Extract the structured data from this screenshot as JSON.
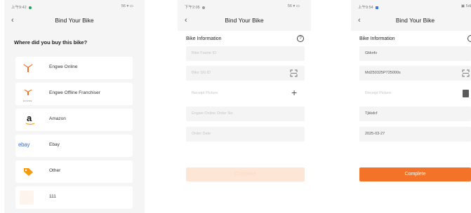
{
  "screen1": {
    "status_time": "上午9:42",
    "status_right": "56 ▾ ▭",
    "back_icon": "‹",
    "title": "Bind Your Bike",
    "question": "Where did you buy this bike?",
    "options": [
      {
        "label": "Engwe Online",
        "icon": "engwe-logo"
      },
      {
        "label": "Engwe Offline Franchiser",
        "icon": "engwe-franchise-logo",
        "icon_caption": "ENGWE"
      },
      {
        "label": "Amazon",
        "icon": "amazon-logo",
        "icon_text": "a"
      },
      {
        "label": "Ebay",
        "icon": "ebay-logo",
        "icon_text": "ebay"
      },
      {
        "label": "Other",
        "icon": "tag-icon"
      },
      {
        "label": "111",
        "icon": "blank"
      }
    ]
  },
  "screen2": {
    "status_time": "下午2:05",
    "status_right": "56 ▾ ▭",
    "back_icon": "‹",
    "title": "Bind Your Bike",
    "section": "Bike Information",
    "help_icon": "?",
    "fields": [
      {
        "placeholder": "Bike Frame ID",
        "value": ""
      },
      {
        "placeholder": "Bike SN ID",
        "value": "",
        "icon": "scan-icon"
      },
      {
        "placeholder": "Receipt Picture",
        "value": "",
        "icon": "plus-icon",
        "icon_text": "+"
      },
      {
        "placeholder": "Engwe Online Order No.",
        "value": ""
      },
      {
        "placeholder": "Order Date",
        "value": ""
      }
    ],
    "button": "Complete",
    "button_state": "disabled"
  },
  "screen3": {
    "status_time": "上午9:54",
    "status_right": "▣ 5di",
    "back_icon": "‹",
    "title": "Bind Your Bike",
    "section": "Bike Information",
    "fields": [
      {
        "placeholder": "Bike Frame ID",
        "value": "Gkknfv"
      },
      {
        "placeholder": "Bike SN ID",
        "value": "Md250325P725000s",
        "icon": "scan-icon"
      },
      {
        "placeholder": "Receipt Picture",
        "value": "",
        "icon": "receipt-thumbnail"
      },
      {
        "placeholder": "Engwe Online Order No.",
        "value": "Tjkkdcf"
      },
      {
        "placeholder": "Order Date",
        "value": "2025-03-27"
      }
    ],
    "button": "Complete",
    "button_state": "enabled",
    "accent": "#f37328"
  }
}
